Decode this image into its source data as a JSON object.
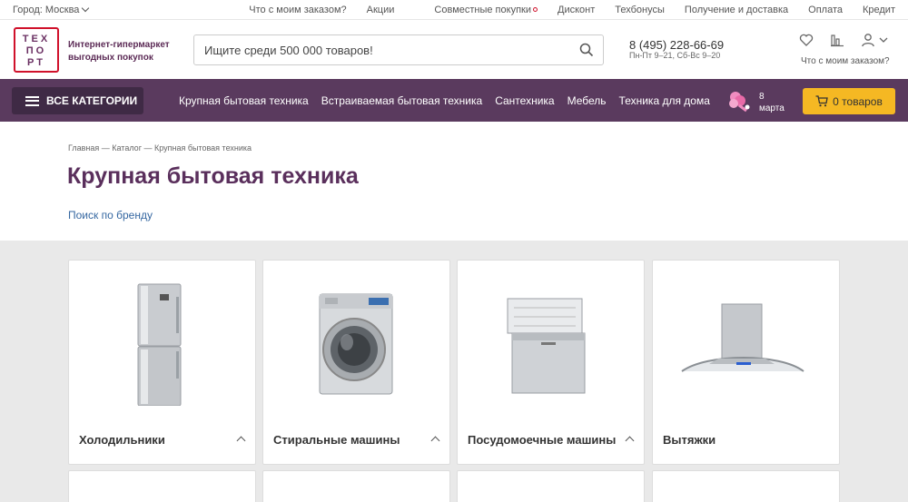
{
  "topbar": {
    "city": "Город: Москва",
    "links": [
      "Что с моим заказом?",
      "Акции",
      "Совместные покупки",
      "Дисконт",
      "Техбонусы",
      "Получение и доставка",
      "Оплата",
      "Кредит"
    ]
  },
  "header": {
    "logo_rows": [
      "ТЕХ",
      "ПО",
      "РТ"
    ],
    "tagline": "Интернет-гипермаркет выгодных покупок",
    "search_placeholder": "Ищите среди 500 000 товаров!",
    "phone": "8 (495) 228-66-69",
    "hours": "Пн-Пт 9–21, Сб-Вс 9–20",
    "order_question": "Что с моим заказом?",
    "icons": [
      "heart-icon",
      "compare-icon",
      "user-icon"
    ]
  },
  "nav": {
    "all_categories": "ВСЕ КАТЕГОРИИ",
    "links": [
      "Крупная бытовая техника",
      "Встраиваемая бытовая техника",
      "Сантехника",
      "Мебель",
      "Техника для дома"
    ],
    "promo_day": "8",
    "promo_month": "марта",
    "cart": "0 товаров"
  },
  "page": {
    "breadcrumb": "Главная — Каталог — Крупная бытовая техника",
    "title": "Крупная бытовая техника",
    "brand_search": "Поиск по бренду"
  },
  "categories": [
    {
      "name": "Холодильники",
      "icon": "fridge-image",
      "expandable": true
    },
    {
      "name": "Стиральные машины",
      "icon": "washing-machine-image",
      "expandable": true
    },
    {
      "name": "Посудомоечные машины",
      "icon": "dishwasher-image",
      "expandable": true
    },
    {
      "name": "Вытяжки",
      "icon": "hood-image",
      "expandable": false
    }
  ],
  "colors": {
    "brand_purple": "#5a3a5e",
    "title_purple": "#5a2f5c",
    "accent_yellow": "#f5b823",
    "logo_red": "#d0112b",
    "link_blue": "#3567a1"
  }
}
